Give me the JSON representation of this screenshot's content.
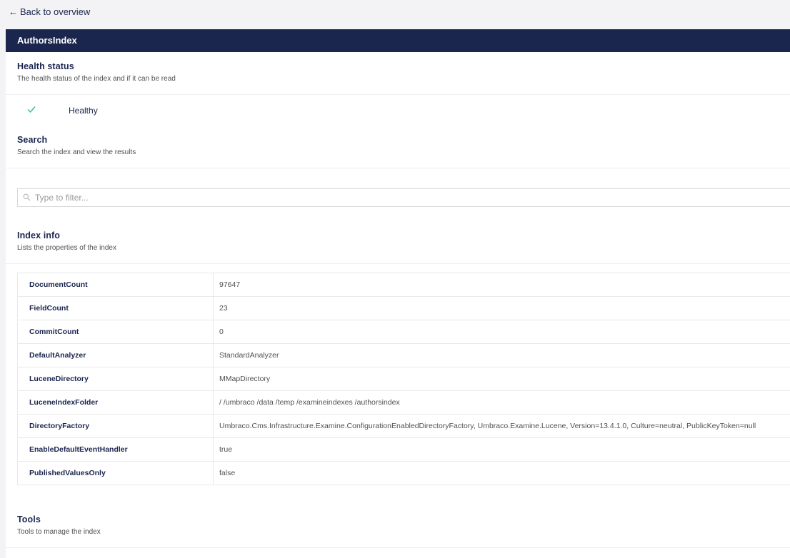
{
  "back_link": {
    "arrow": "←",
    "label": "Back to overview"
  },
  "panel": {
    "title": "AuthorsIndex"
  },
  "health": {
    "title": "Health status",
    "description": "The health status of the index and if it can be read",
    "status": "Healthy"
  },
  "search": {
    "title": "Search",
    "description": "Search the index and view the results",
    "placeholder": "Type to filter..."
  },
  "index_info": {
    "title": "Index info",
    "description": "Lists the properties of the index",
    "rows": [
      {
        "key": "DocumentCount",
        "value": "97647"
      },
      {
        "key": "FieldCount",
        "value": "23"
      },
      {
        "key": "CommitCount",
        "value": "0"
      },
      {
        "key": "DefaultAnalyzer",
        "value": "StandardAnalyzer"
      },
      {
        "key": "LuceneDirectory",
        "value": "MMapDirectory"
      },
      {
        "key": "LuceneIndexFolder",
        "value": "/ /umbraco /data /temp /examineindexes /authorsindex"
      },
      {
        "key": "DirectoryFactory",
        "value": "Umbraco.Cms.Infrastructure.Examine.ConfigurationEnabledDirectoryFactory, Umbraco.Examine.Lucene, Version=13.4.1.0, Culture=neutral, PublicKeyToken=null"
      },
      {
        "key": "EnableDefaultEventHandler",
        "value": "true"
      },
      {
        "key": "PublishedValuesOnly",
        "value": "false"
      }
    ]
  },
  "tools": {
    "title": "Tools",
    "description": "Tools to manage the index"
  },
  "colors": {
    "header_bg": "#1b264f",
    "healthy": "#2bc37c",
    "text": "#1b264f"
  }
}
